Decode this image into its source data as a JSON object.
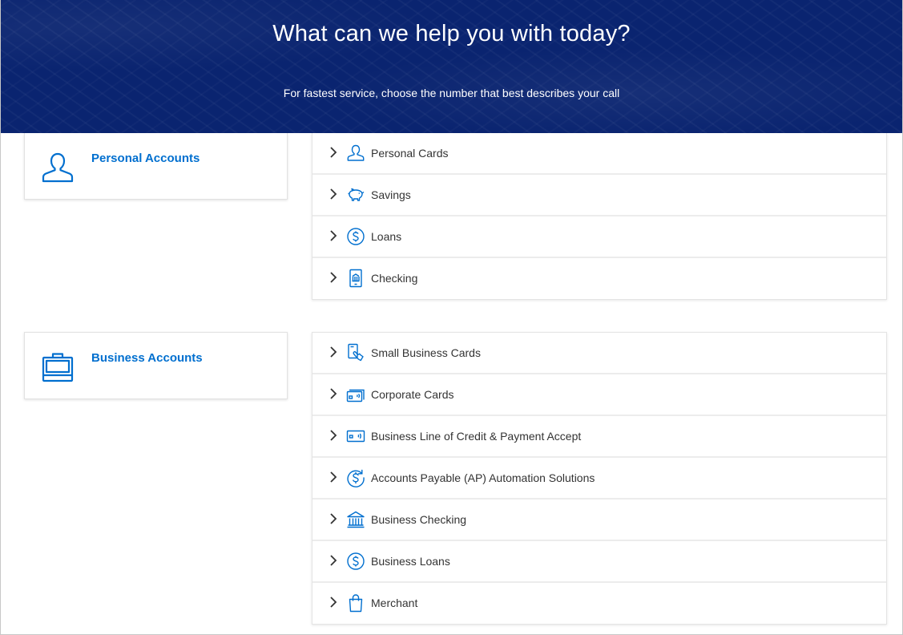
{
  "header": {
    "title": "What can we help you with today?",
    "subtitle": "For fastest service, choose the number that best describes your call"
  },
  "colors": {
    "hero_bg": "#0a2470",
    "accent": "#006fcf",
    "text": "#333333"
  },
  "sections": [
    {
      "label": "Personal Accounts",
      "icon": "person-icon",
      "items": [
        {
          "label": "Personal Cards",
          "icon": "person-icon"
        },
        {
          "label": "Savings",
          "icon": "piggy-bank-icon"
        },
        {
          "label": "Loans",
          "icon": "dollar-circle-icon"
        },
        {
          "label": "Checking",
          "icon": "mobile-bank-icon"
        }
      ]
    },
    {
      "label": "Business Accounts",
      "icon": "briefcase-icon",
      "items": [
        {
          "label": "Small Business Cards",
          "icon": "card-hand-icon"
        },
        {
          "label": "Corporate Cards",
          "icon": "cards-icon"
        },
        {
          "label": "Business Line of Credit & Payment Accept",
          "icon": "contactless-card-icon"
        },
        {
          "label": "Accounts Payable (AP) Automation Solutions",
          "icon": "dollar-refresh-icon"
        },
        {
          "label": "Business Checking",
          "icon": "bank-icon"
        },
        {
          "label": "Business Loans",
          "icon": "dollar-circle-icon"
        },
        {
          "label": "Merchant",
          "icon": "shopping-bag-icon"
        }
      ]
    }
  ]
}
